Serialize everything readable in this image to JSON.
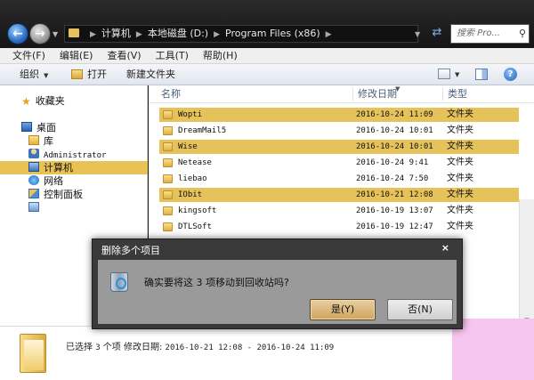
{
  "address_bar": {
    "crumbs": [
      "计算机",
      "本地磁盘 (D:)",
      "Program Files (x86)"
    ],
    "search_placeholder": "搜索 Pro..."
  },
  "menu": [
    "文件(F)",
    "编辑(E)",
    "查看(V)",
    "工具(T)",
    "帮助(H)"
  ],
  "toolbar": {
    "organize": "组织",
    "open": "打开",
    "new_folder": "新建文件夹"
  },
  "nav": {
    "favorites": "收藏夹",
    "desktop": "桌面",
    "library": "库",
    "user": "Administrator",
    "computer": "计算机",
    "network": "网络",
    "control_panel": "控制面板"
  },
  "columns": {
    "name": "名称",
    "date": "修改日期",
    "type": "类型"
  },
  "files": [
    {
      "name": "Wopti",
      "date": "2016-10-24 11:09",
      "type": "文件夹",
      "selected": true
    },
    {
      "name": "DreamMail5",
      "date": "2016-10-24 10:01",
      "type": "文件夹",
      "selected": false
    },
    {
      "name": "Wise",
      "date": "2016-10-24 10:01",
      "type": "文件夹",
      "selected": true
    },
    {
      "name": "Netease",
      "date": "2016-10-24 9:41",
      "type": "文件夹",
      "selected": false
    },
    {
      "name": "liebao",
      "date": "2016-10-24 7:50",
      "type": "文件夹",
      "selected": false
    },
    {
      "name": "IObit",
      "date": "2016-10-21 12:08",
      "type": "文件夹",
      "selected": true
    },
    {
      "name": "kingsoft",
      "date": "2016-10-19 13:07",
      "type": "文件夹",
      "selected": false
    },
    {
      "name": "DTLSoft",
      "date": "2016-10-19 12:47",
      "type": "文件夹",
      "selected": false
    }
  ],
  "details": {
    "selected_label": "已选择",
    "selected_count": "3",
    "unit": "个项",
    "date_label": "修改日期:",
    "date_range": "2016-10-21 12:08 - 2016-10-24 11:09"
  },
  "dialog": {
    "title": "删除多个项目",
    "close": "×",
    "message": "确实要将这 3 项移动到回收站吗?",
    "yes": "是(Y)",
    "no": "否(N)"
  }
}
